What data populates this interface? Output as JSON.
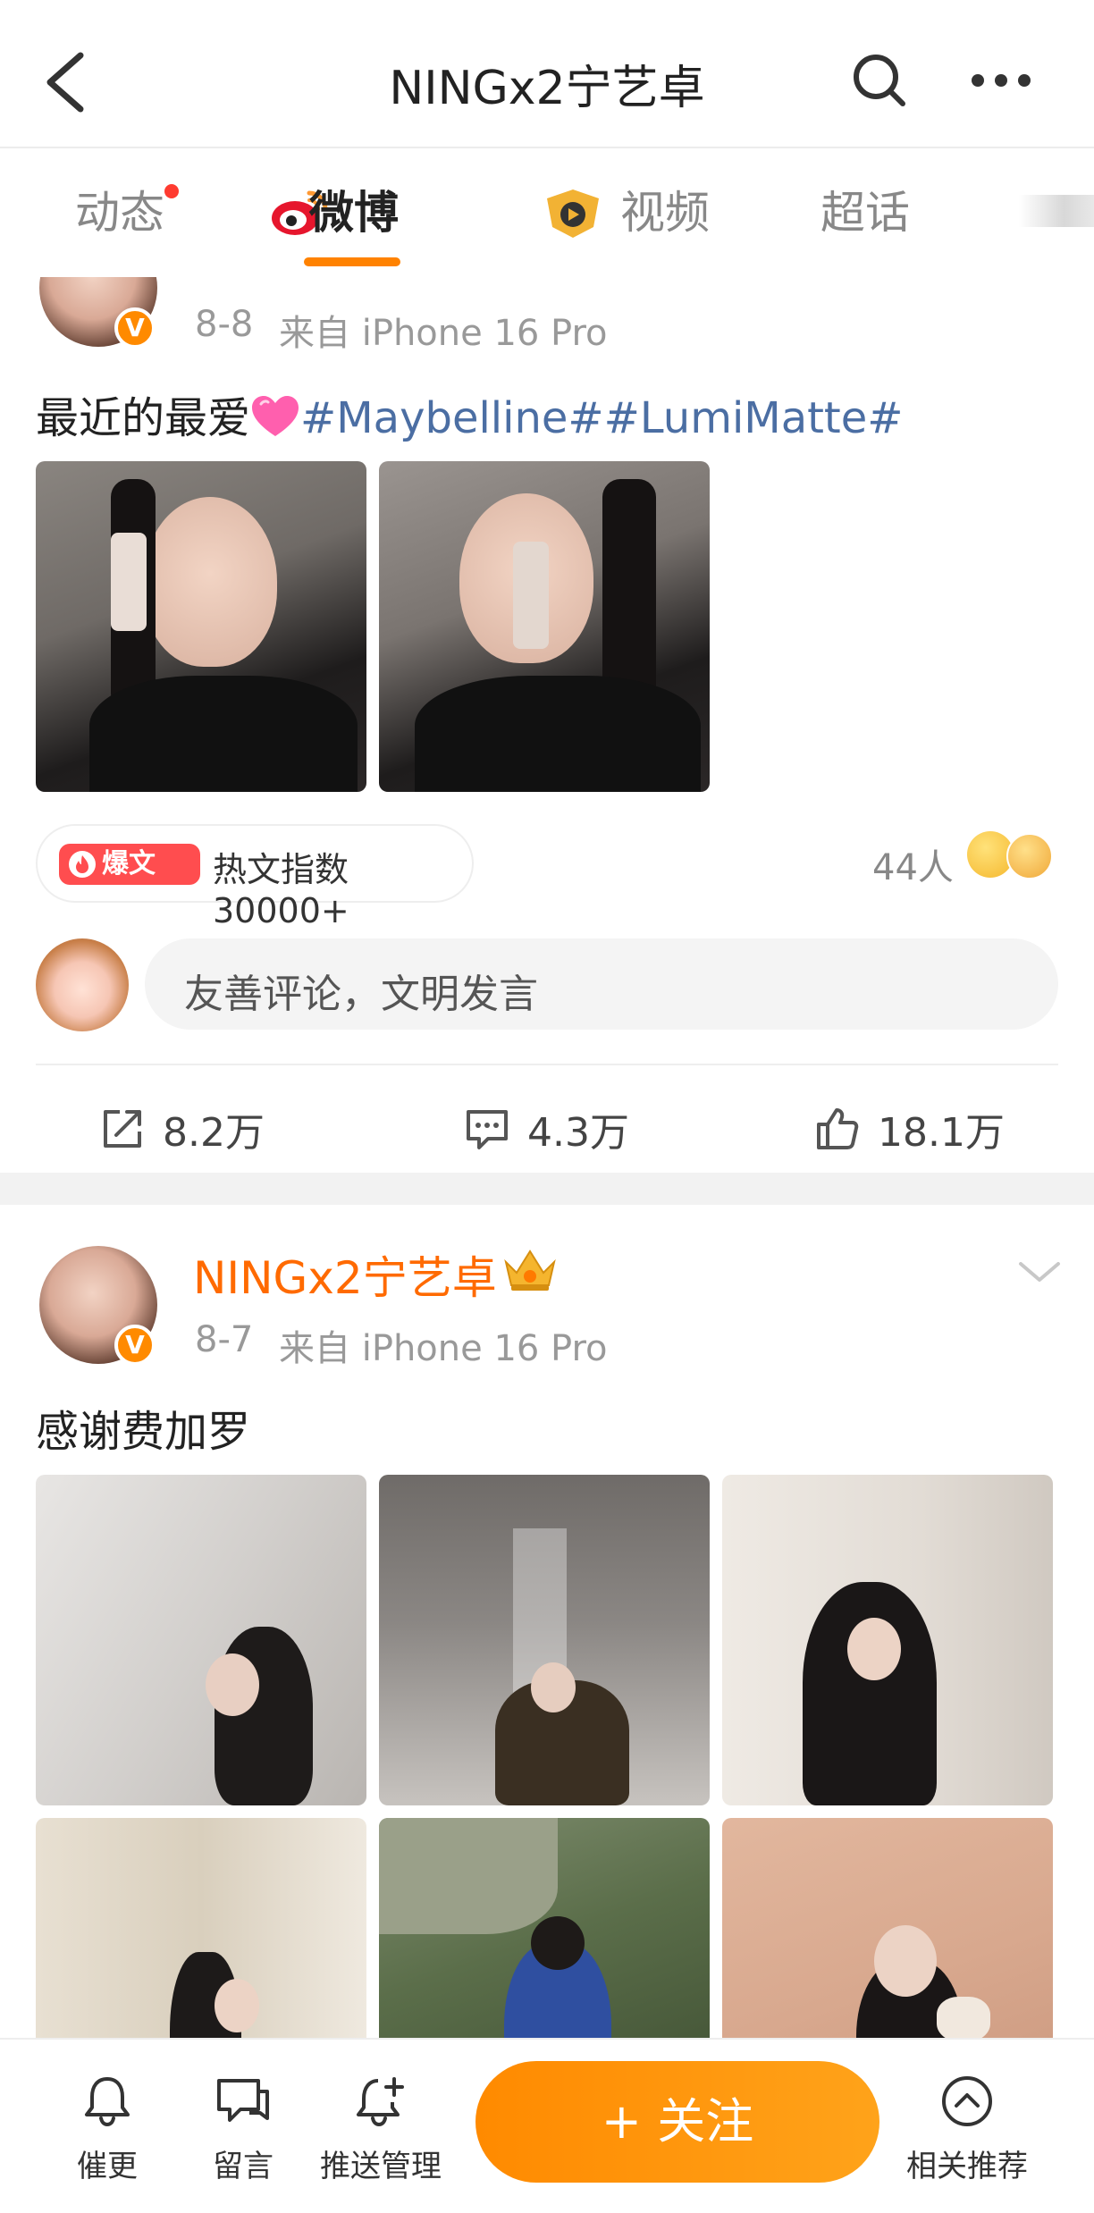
{
  "header": {
    "title": "NINGx2宁艺卓",
    "back_icon": "chevron-left-icon",
    "search_icon": "search-icon",
    "more_icon": "more-icon"
  },
  "tabs": [
    {
      "label": "动态",
      "active": false,
      "has_dot": true
    },
    {
      "label": "微博",
      "active": true,
      "icon": "weibo-logo-icon"
    },
    {
      "label": "视频",
      "active": false,
      "icon": "video-icon"
    },
    {
      "label": "超话",
      "active": false
    }
  ],
  "colors": {
    "accent": "#ff8200",
    "username": "#ff6a00",
    "hashtag": "#4b6ea3",
    "hot": "#ff4d4f"
  },
  "posts": [
    {
      "date": "8-8",
      "source": "来自 iPhone 16 Pro",
      "text_plain": "最近的最爱",
      "emoji": "pink-heart",
      "hashtags": "#Maybelline##LumiMatte#",
      "hot_badge": "爆文",
      "hot_text": "热文指数30000+",
      "reaction_count": "44人",
      "comment_placeholder": "友善评论，文明发言",
      "repost_count": "8.2万",
      "comment_count": "4.3万",
      "like_count": "18.1万"
    },
    {
      "author": "NINGx2宁艺卓",
      "date": "8-7",
      "source": "来自 iPhone 16 Pro",
      "text": "感谢费加罗"
    }
  ],
  "bottom_bar": {
    "items": [
      {
        "label": "催更",
        "icon": "bell-icon"
      },
      {
        "label": "留言",
        "icon": "message-icon"
      },
      {
        "label": "推送管理",
        "icon": "bell-plus-icon"
      },
      {
        "label": "相关推荐",
        "icon": "chevron-up-circle-icon"
      }
    ],
    "follow_label": "+ 关注"
  }
}
